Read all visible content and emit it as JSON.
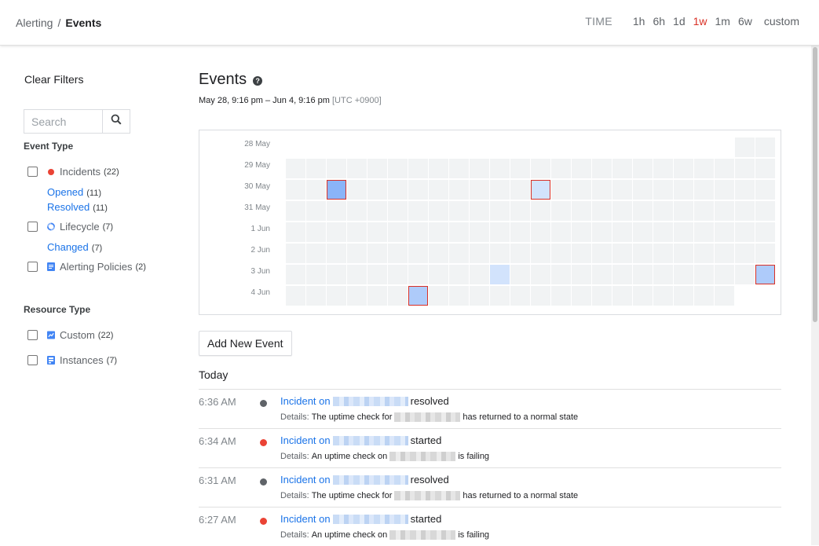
{
  "header": {
    "breadcrumb_parent": "Alerting",
    "breadcrumb_sep": "/",
    "breadcrumb_current": "Events",
    "time_label": "TIME",
    "time_options": [
      "1h",
      "6h",
      "1d",
      "1w",
      "1m",
      "6w",
      "custom"
    ],
    "time_selected": "1w"
  },
  "sidebar": {
    "clear_filters": "Clear Filters",
    "search_placeholder": "Search",
    "event_type_title": "Event Type",
    "event_types": [
      {
        "label": "Incidents",
        "count": "(22)",
        "icon": "red-dot-icon"
      },
      {
        "label": "Lifecycle",
        "count": "(7)",
        "icon": "lifecycle-icon"
      },
      {
        "label": "Alerting Policies",
        "count": "(2)",
        "icon": "document-icon"
      }
    ],
    "incident_subs": [
      {
        "label": "Opened",
        "count": "(11)"
      },
      {
        "label": "Resolved",
        "count": "(11)"
      }
    ],
    "lifecycle_subs": [
      {
        "label": "Changed",
        "count": "(7)"
      }
    ],
    "resource_type_title": "Resource Type",
    "resource_types": [
      {
        "label": "Custom",
        "count": "(22)",
        "icon": "chart-icon"
      },
      {
        "label": "Instances",
        "count": "(7)",
        "icon": "instance-icon"
      }
    ]
  },
  "main": {
    "title": "Events",
    "range": "May 28, 9:16 pm – Jun 4, 9:16 pm",
    "timezone": "[UTC +0900]",
    "add_button": "Add New Event",
    "today_label": "Today"
  },
  "heatmap": {
    "days": [
      "28 May",
      "29 May",
      "30 May",
      "31 May",
      "1 Jun",
      "2 Jun",
      "3 Jun",
      "4 Jun"
    ],
    "hours_per_day": 24,
    "first_day_start_hour": 22,
    "last_day_hours": 22,
    "highlights": [
      {
        "day": 2,
        "hour": 2,
        "level": "dark",
        "selected": true
      },
      {
        "day": 2,
        "hour": 12,
        "level": "light",
        "selected": true
      },
      {
        "day": 6,
        "hour": 10,
        "level": "light",
        "selected": false
      },
      {
        "day": 6,
        "hour": 23,
        "level": "mid",
        "selected": true
      },
      {
        "day": 7,
        "hour": 6,
        "level": "mid",
        "selected": true
      }
    ]
  },
  "events": [
    {
      "time": "6:36 AM",
      "dot_color": "#5f6368",
      "title_prefix": "Incident on",
      "status": "resolved",
      "details_label": "Details:",
      "details_before": "The uptime check for",
      "details_after": "has returned to a normal state"
    },
    {
      "time": "6:34 AM",
      "dot_color": "#ea4335",
      "title_prefix": "Incident on",
      "status": "started",
      "details_label": "Details:",
      "details_before": "An uptime check on",
      "details_after": "is failing"
    },
    {
      "time": "6:31 AM",
      "dot_color": "#5f6368",
      "title_prefix": "Incident on",
      "status": "resolved",
      "details_label": "Details:",
      "details_before": "The uptime check for",
      "details_after": "has returned to a normal state"
    },
    {
      "time": "6:27 AM",
      "dot_color": "#ea4335",
      "title_prefix": "Incident on",
      "status": "started",
      "details_label": "Details:",
      "details_before": "An uptime check on",
      "details_after": "is failing"
    }
  ]
}
